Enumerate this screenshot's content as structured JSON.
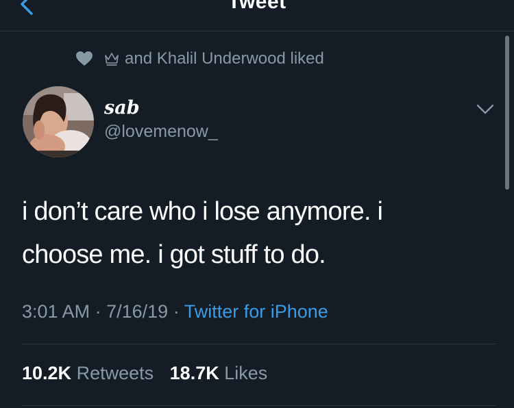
{
  "header": {
    "title": "Tweet",
    "back_icon": "chevron-left-icon",
    "accent_color": "#3b9ce6"
  },
  "social_context": {
    "heart_icon": "heart-icon",
    "crown_icon": "crown-icon",
    "text": "and Khalil Underwood liked"
  },
  "tweet": {
    "author_name": "sab",
    "author_handle": "@lovemenow_",
    "text_line1": "i don’t care who i lose anymore. i",
    "text_line2": "choose me. i got stuff to do.",
    "time": "3:01 AM",
    "date": "7/16/19",
    "separator": "·",
    "source": "Twitter for iPhone"
  },
  "stats": {
    "retweets_count": "10.2K",
    "retweets_label": "Retweets",
    "likes_count": "18.7K",
    "likes_label": "Likes"
  },
  "colors": {
    "background": "#141d26",
    "secondary_text": "#8899a6",
    "link": "#3b9ce6",
    "divider": "#2c3640"
  }
}
